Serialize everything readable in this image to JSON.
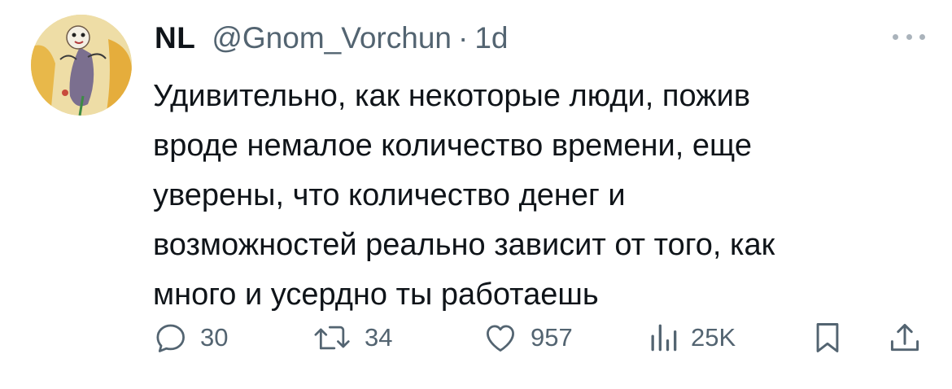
{
  "author": {
    "display_name": "NL",
    "handle": "@Gnom_Vorchun",
    "separator": "·",
    "time": "1d"
  },
  "tweet": {
    "lines": [
      "Удивительно, как некоторые люди, пожив",
      "вроде немалое количество времени, еще",
      "уверены, что количество денег и",
      "возможностей реально зависит от того, как",
      "много и усердно ты работаешь"
    ]
  },
  "metrics": {
    "replies": "30",
    "retweets": "34",
    "likes": "957",
    "views": "25K"
  },
  "icons": {
    "more": "more-horizontal-icon",
    "reply": "reply-icon",
    "retweet": "retweet-icon",
    "like": "heart-icon",
    "views": "views-chart-icon",
    "bookmark": "bookmark-icon",
    "share": "share-icon"
  },
  "colors": {
    "text": "#0f1419",
    "secondary": "#536471",
    "more_dots": "#aab3bb"
  }
}
